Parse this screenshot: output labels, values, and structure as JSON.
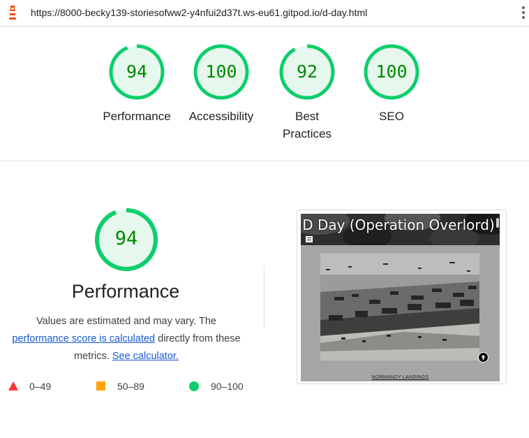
{
  "address_bar": {
    "url": "https://8000-becky139-storiesofww2-y4nfui2d37t.ws-eu61.gitpod.io/d-day.html"
  },
  "colors": {
    "pass": "#0cce6b",
    "pass_text": "#008800",
    "pass_fill": "#e6f7ee",
    "average": "#ffa400",
    "fail": "#ff3333",
    "link": "#1558d6"
  },
  "categories": [
    {
      "score": "94",
      "score_fraction": 0.94,
      "label": "Performance"
    },
    {
      "score": "100",
      "score_fraction": 1.0,
      "label": "Accessibility"
    },
    {
      "score": "92",
      "score_fraction": 0.92,
      "label": "Best Practices"
    },
    {
      "score": "100",
      "score_fraction": 1.0,
      "label": "SEO"
    }
  ],
  "performance": {
    "score": "94",
    "score_fraction": 0.94,
    "title": "Performance",
    "desc_before": "Values are estimated and may vary. The ",
    "desc_link": "performance score is calculated",
    "desc_middle": " directly from these metrics. ",
    "desc_link2": "See calculator."
  },
  "legend": [
    {
      "shape": "triangle",
      "range": "0–49"
    },
    {
      "shape": "square",
      "range": "50–89"
    },
    {
      "shape": "circle",
      "range": "90–100"
    }
  ],
  "screenshot": {
    "title": "D Day (Operation Overlord)",
    "caption": "NORMANDY LANDINGS"
  }
}
